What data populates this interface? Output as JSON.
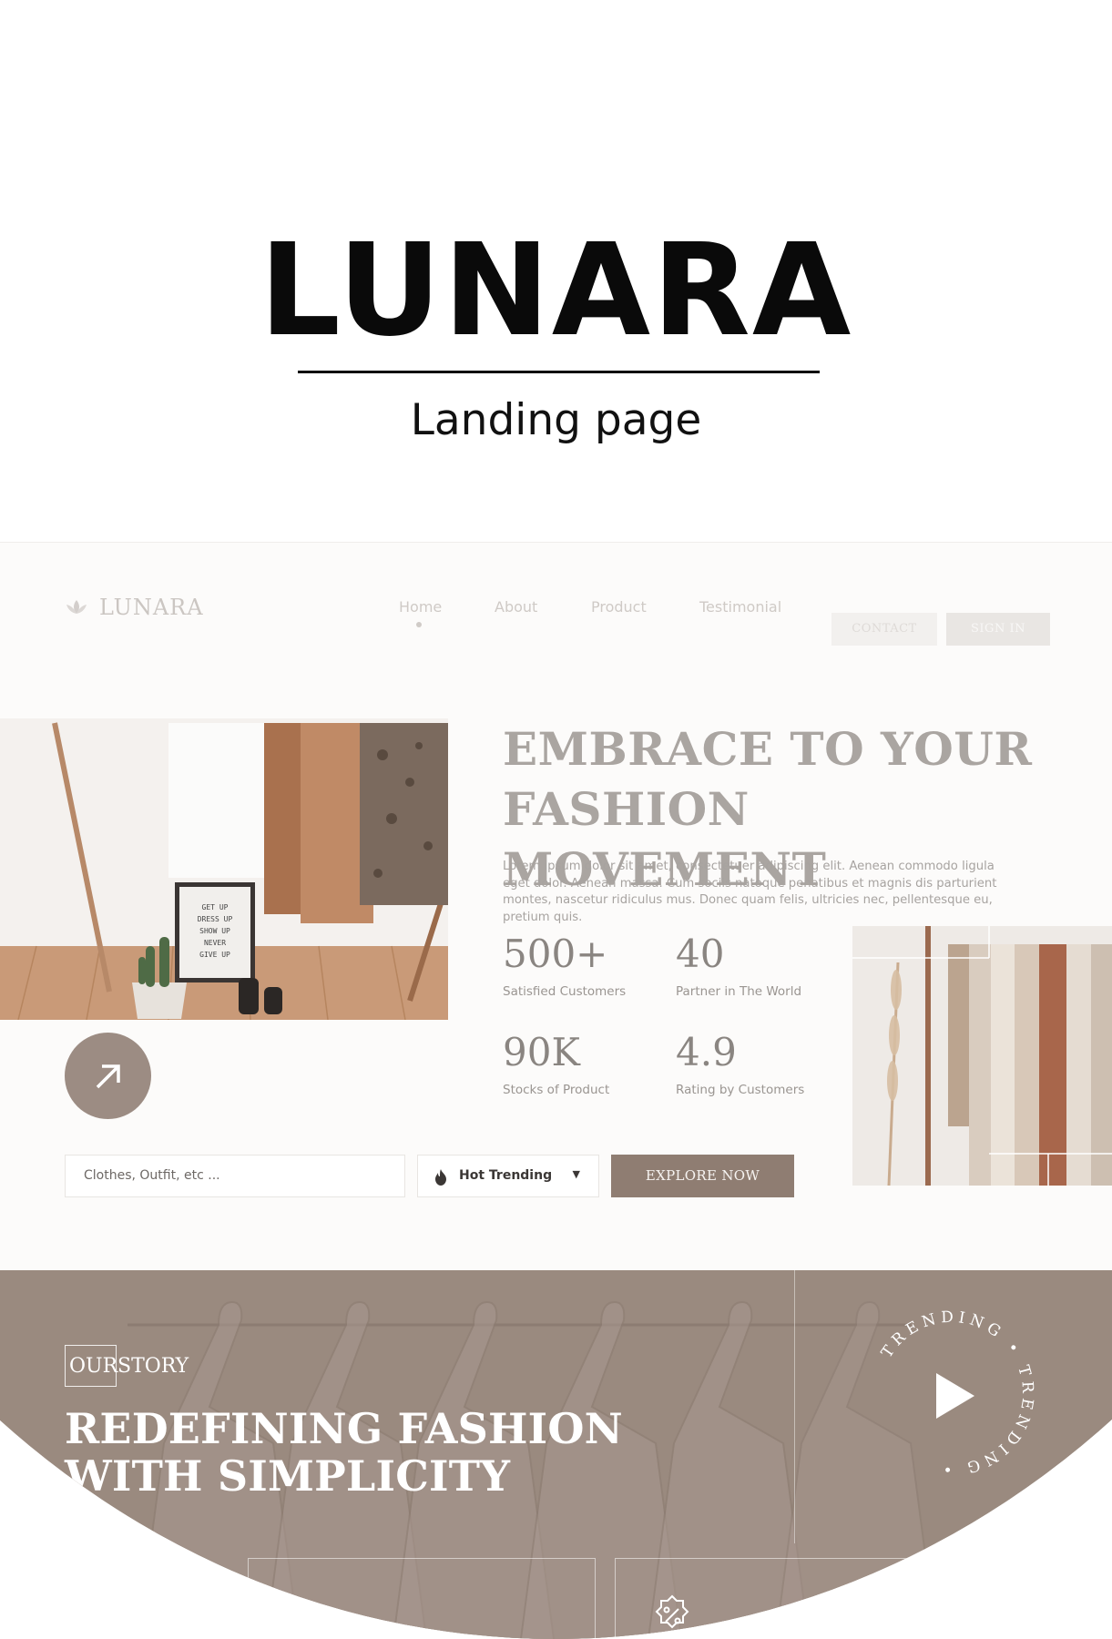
{
  "cover": {
    "title": "LUNARA",
    "subtitle": "Landing page"
  },
  "nav": {
    "logo_text": "LUNARA",
    "logo_icon": "lotus-icon",
    "links": [
      "Home",
      "About",
      "Product",
      "Testimonial"
    ],
    "active_link": "Home",
    "contact_label": "CONTACT",
    "signin_label": "SIGN IN"
  },
  "hero": {
    "title_line1": "EMBRACE TO YOUR",
    "title_line2": "FASHION MOVEMENT",
    "description": "Lorem ipsum dolor sit amet, consectetuer adipiscing elit. Aenean commodo ligula eget dolor. Aenean massa. Cum sociis natoque penatibus et magnis dis parturient montes, nascetur ridiculus mus. Donec quam felis, ultricies nec, pellentesque eu, pretium quis.",
    "letterboard_text": "GET UP DRESS UP SHOW UP NEVER GIVE UP",
    "arrow_icon": "arrow-up-right-icon",
    "stats": [
      {
        "value": "500+",
        "label": "Satisfied Customers"
      },
      {
        "value": "40",
        "label": "Partner in The World"
      },
      {
        "value": "90K",
        "label": "Stocks of Product"
      },
      {
        "value": "4.9",
        "label": "Rating by Customers"
      }
    ]
  },
  "search": {
    "placeholder": "Clothes, Outfit, etc ...",
    "category_icon": "fire-icon",
    "category_value": "Hot Trending",
    "explore_label": "EXPLORE NOW"
  },
  "story": {
    "tag_boxed": "OUR",
    "tag_rest": "STORY",
    "title_line1": "REDEFINING FASHION",
    "title_line2": "WITH SIMPLICITY",
    "badge_text": "TRENDING • TRENDING •",
    "play_icon": "play-icon",
    "card_icon": "discount-badge-icon"
  },
  "colors": {
    "accent": "#8f7d72",
    "story_bg": "#9a8a7f",
    "heading_gray": "#aaa5a1"
  }
}
